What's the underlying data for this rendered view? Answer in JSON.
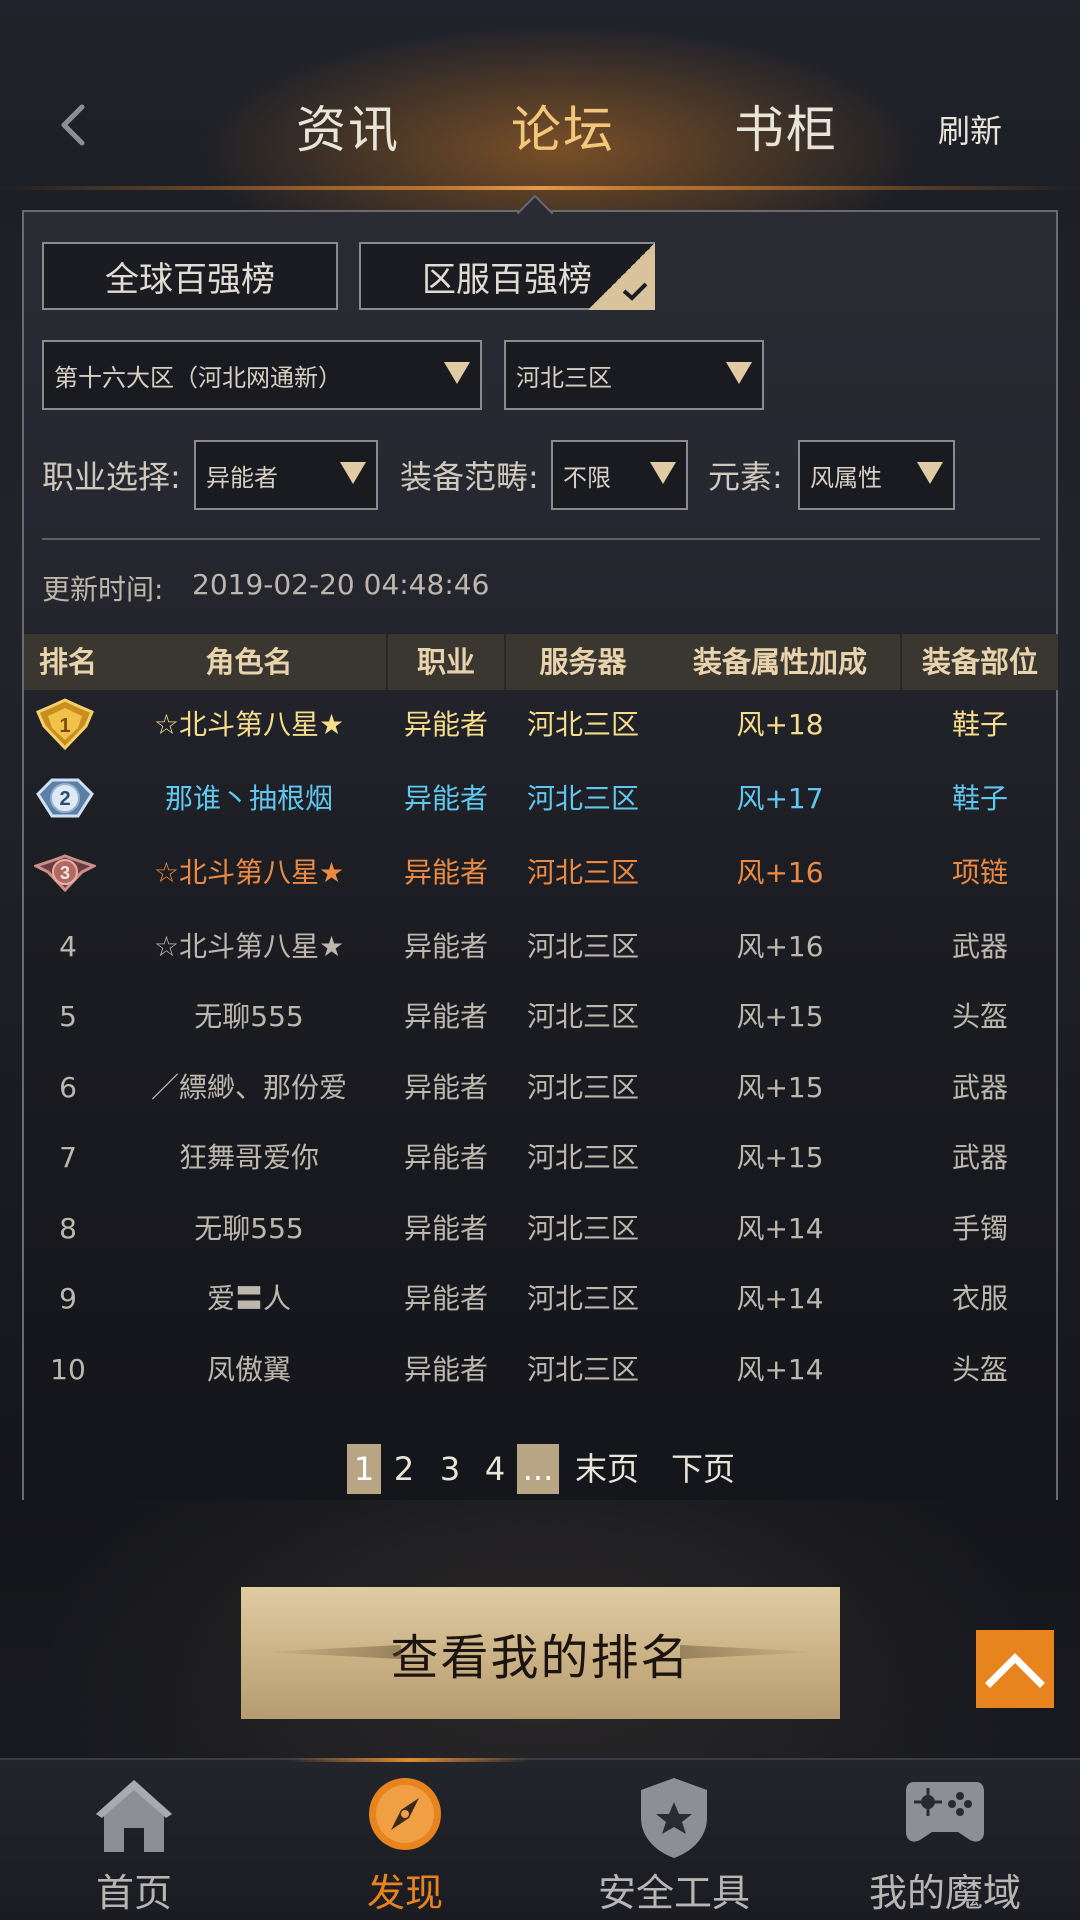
{
  "header": {
    "tabs": [
      {
        "label": "资讯",
        "active": false
      },
      {
        "label": "论坛",
        "active": true
      },
      {
        "label": "书柜",
        "active": false
      }
    ],
    "refresh_label": "刷新",
    "active_color": "#f2c77a"
  },
  "filters": {
    "rank_buttons": {
      "global": "全球百强榜",
      "server": "区服百强榜",
      "selected": "server"
    },
    "region_select": "第十六大区（河北网通新）",
    "server_select": "河北三区",
    "job_label": "职业选择:",
    "job_value": "异能者",
    "equip_label": "装备范畴:",
    "equip_value": "不限",
    "element_label": "元素:",
    "element_value": "风属性"
  },
  "update": {
    "label": "更新时间:",
    "value": "2019-02-20 04:48:46"
  },
  "table": {
    "headers": [
      "排名",
      "角色名",
      "职业",
      "服务器",
      "装备属性加成",
      "装备部位"
    ],
    "rows": [
      {
        "rank": "1",
        "name": "☆北斗第八星★",
        "job": "异能者",
        "server": "河北三区",
        "bonus": "风+18",
        "slot": "鞋子",
        "tier": "gold"
      },
      {
        "rank": "2",
        "name": "那谁丶抽根烟",
        "job": "异能者",
        "server": "河北三区",
        "bonus": "风+17",
        "slot": "鞋子",
        "tier": "silver"
      },
      {
        "rank": "3",
        "name": "☆北斗第八星★",
        "job": "异能者",
        "server": "河北三区",
        "bonus": "风+16",
        "slot": "项链",
        "tier": "bronze"
      },
      {
        "rank": "4",
        "name": "☆北斗第八星★",
        "job": "异能者",
        "server": "河北三区",
        "bonus": "风+16",
        "slot": "武器",
        "tier": "normal"
      },
      {
        "rank": "5",
        "name": "无聊555",
        "job": "异能者",
        "server": "河北三区",
        "bonus": "风+15",
        "slot": "头盔",
        "tier": "normal"
      },
      {
        "rank": "6",
        "name": "／縹緲、那份爱",
        "job": "异能者",
        "server": "河北三区",
        "bonus": "风+15",
        "slot": "武器",
        "tier": "normal"
      },
      {
        "rank": "7",
        "name": "狂舞哥爱你",
        "job": "异能者",
        "server": "河北三区",
        "bonus": "风+15",
        "slot": "武器",
        "tier": "normal"
      },
      {
        "rank": "8",
        "name": "无聊555",
        "job": "异能者",
        "server": "河北三区",
        "bonus": "风+14",
        "slot": "手镯",
        "tier": "normal"
      },
      {
        "rank": "9",
        "name": "爱〓人",
        "job": "异能者",
        "server": "河北三区",
        "bonus": "风+14",
        "slot": "衣服",
        "tier": "normal"
      },
      {
        "rank": "10",
        "name": "凤傲翼",
        "job": "异能者",
        "server": "河北三区",
        "bonus": "风+14",
        "slot": "头盔",
        "tier": "normal"
      }
    ],
    "colors": {
      "gold": "#f5dd8a",
      "silver": "#5fc8f0",
      "bronze": "#ec8a43",
      "normal": "#bdb8ae"
    }
  },
  "pagination": {
    "pages": [
      "1",
      "2",
      "3",
      "4"
    ],
    "current": "1",
    "ellipsis": "...",
    "last_label": "末页",
    "next_label": "下页"
  },
  "my_rank_label": "查看我的排名",
  "bottom_nav": [
    {
      "label": "首页",
      "icon": "home-icon",
      "active": false
    },
    {
      "label": "发现",
      "icon": "compass-icon",
      "active": true
    },
    {
      "label": "安全工具",
      "icon": "shield-star-icon",
      "active": false
    },
    {
      "label": "我的魔域",
      "icon": "gamepad-icon",
      "active": false
    }
  ],
  "accent_color": "#e8841d"
}
